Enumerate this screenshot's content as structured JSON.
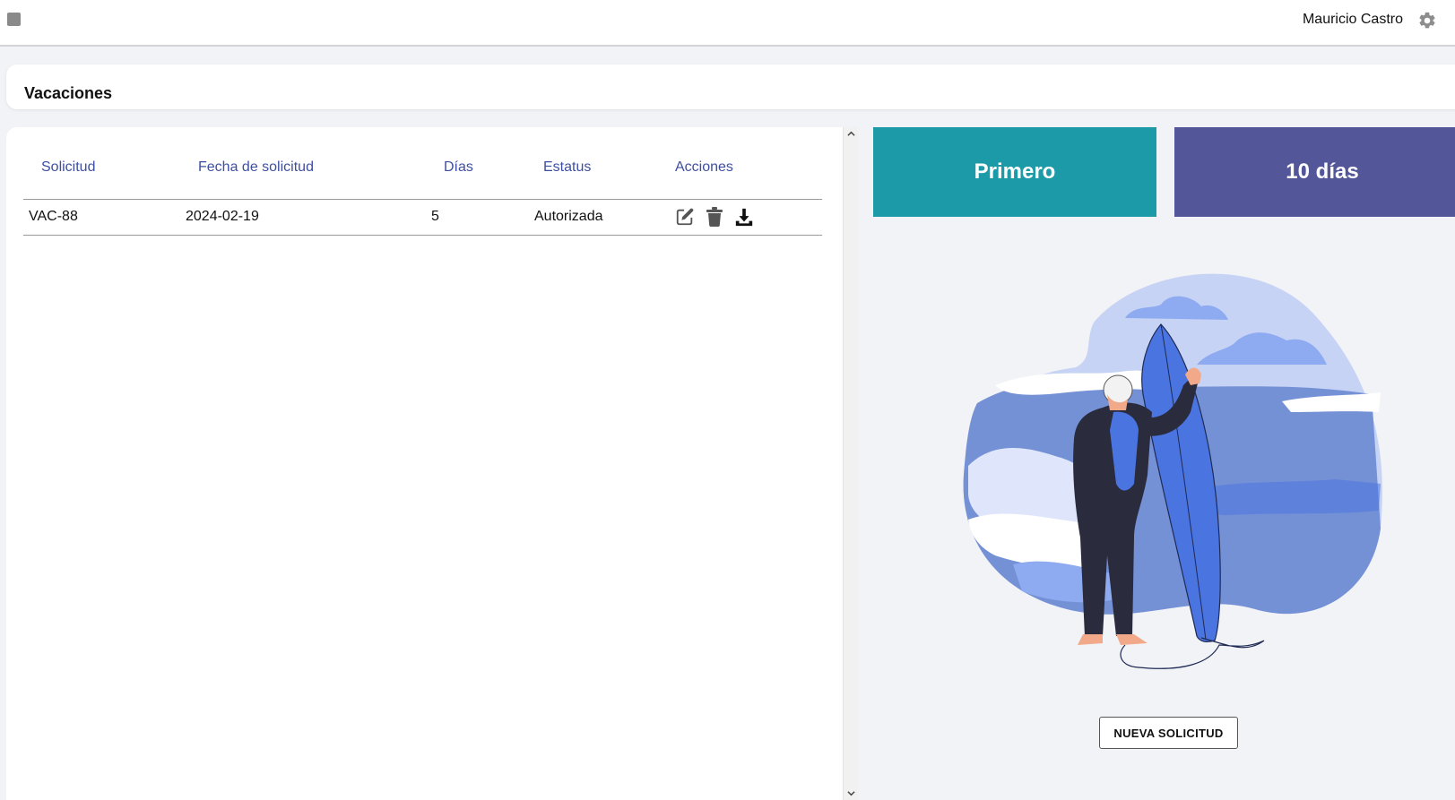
{
  "header": {
    "user_name": "Mauricio Castro",
    "settings_icon": "gear-icon",
    "menu_icon": "menu-square-icon"
  },
  "page": {
    "title": "Vacaciones"
  },
  "table": {
    "columns": [
      "Solicitud",
      "Fecha de solicitud",
      "Días",
      "Estatus",
      "Acciones"
    ],
    "rows": [
      {
        "solicitud": "VAC-88",
        "fecha": "2024-02-19",
        "dias": "5",
        "estatus": "Autorizada",
        "actions": [
          "edit-icon",
          "trash-icon",
          "download-icon"
        ]
      }
    ]
  },
  "stats": {
    "period_label": "Primero",
    "days_label": "10 días",
    "period_color": "#1d9aa8",
    "days_color": "#53579a"
  },
  "actions": {
    "new_request_label": "NUEVA SOLICITUD"
  },
  "colors": {
    "header_text": "#3f4fa0",
    "accent_blue": "#4a74e0"
  }
}
